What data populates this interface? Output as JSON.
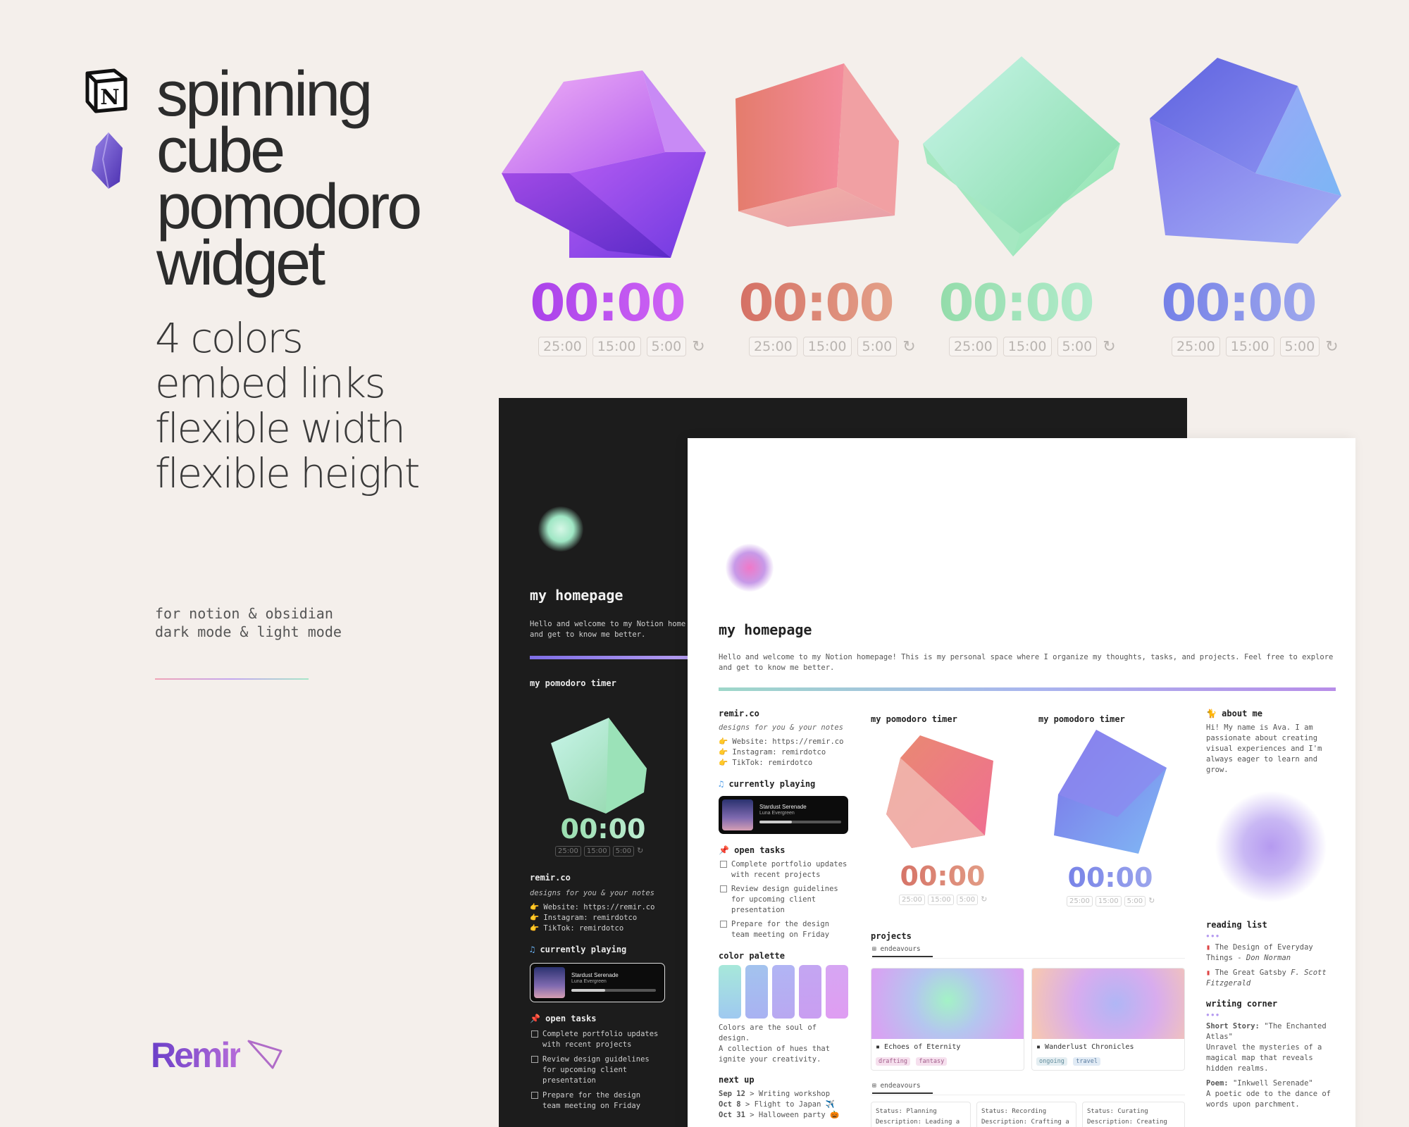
{
  "hero": {
    "title_lines": [
      "spinning",
      "cube",
      "pomodoro",
      "widget"
    ],
    "features": [
      "4 colors",
      "embed links",
      "flexible width",
      "flexible height"
    ],
    "tagline": [
      "for notion & obsidian",
      "dark mode & light mode"
    ],
    "brand": "Remir"
  },
  "widgets": [
    {
      "time": "00:00",
      "presets": [
        "25:00",
        "15:00",
        "5:00"
      ],
      "color": "purple"
    },
    {
      "time": "00:00",
      "presets": [
        "25:00",
        "15:00",
        "5:00"
      ],
      "color": "coral"
    },
    {
      "time": "00:00",
      "presets": [
        "25:00",
        "15:00",
        "5:00"
      ],
      "color": "mint"
    },
    {
      "time": "00:00",
      "presets": [
        "25:00",
        "15:00",
        "5:00"
      ],
      "color": "blue"
    }
  ],
  "colors": {
    "purple": [
      "#a23be8",
      "#d86cf7"
    ],
    "coral": [
      "#d2675e",
      "#e6a98f"
    ],
    "mint": [
      "#8ed9a4",
      "#b6eed1"
    ],
    "blue": [
      "#6c78e6",
      "#a7b0ee"
    ],
    "bg": "#f4efeb",
    "dark_bg": "#1c1c1c"
  },
  "dark": {
    "title": "my homepage",
    "intro_1": "Hello and welcome to my Notion home",
    "intro_2": "and get to know me better.",
    "pomodoro_heading": "my pomodoro timer",
    "timer": "00:00",
    "presets": [
      "25:00",
      "15:00",
      "5:00"
    ],
    "remir_heading": "remir.co",
    "remir_sub": "designs for you & your notes",
    "links": [
      "Website: https://remir.co",
      "Instagram: remirdotco",
      "TikTok: remirdotco"
    ],
    "playing_heading": "currently playing",
    "song": "Stardust Serenade",
    "artist": "Luna Evergreen",
    "tasks_heading": "open tasks",
    "tasks": [
      [
        "Complete portfolio updates",
        "with recent projects"
      ],
      [
        "Review design guidelines",
        "for upcoming client",
        "presentation"
      ],
      [
        "Prepare for the design",
        "team meeting on Friday"
      ]
    ]
  },
  "light": {
    "title": "my homepage",
    "intro_1": "Hello and welcome to my Notion homepage! This is my personal space where I organize my thoughts, tasks, and projects. Feel free to explore",
    "intro_2": "and get to know me better.",
    "remir_heading": "remir.co",
    "remir_sub": "designs for you & your notes",
    "links": [
      "Website: https://remir.co",
      "Instagram: remirdotco",
      "TikTok: remirdotco"
    ],
    "playing_heading": "currently playing",
    "song": "Stardust Serenade",
    "artist": "Luna Evergreen",
    "tasks_heading": "open tasks",
    "tasks": [
      [
        "Complete portfolio updates",
        "with recent projects"
      ],
      [
        "Review design guidelines",
        "for upcoming client",
        "presentation"
      ],
      [
        "Prepare for the design",
        "team meeting on Friday"
      ]
    ],
    "palette_heading": "color palette",
    "palette_text": [
      "Colors are the soul of",
      "design.",
      "A collection of hues that",
      "ignite your creativity."
    ],
    "palette_colors": [
      "#9fdcd3",
      "#a3c3ee",
      "#b7aef3",
      "#c79cf2",
      "#d9a2f3"
    ],
    "nextup_heading": "next up",
    "nextup": [
      {
        "date": "Sep 12",
        "text": "> Writing workshop"
      },
      {
        "date": "Oct 8",
        "text": "> Flight to Japan ✈️"
      },
      {
        "date": "Oct 31",
        "text": "> Halloween party 🎃"
      }
    ],
    "pomo1_heading": "my pomodoro timer",
    "pomo2_heading": "my pomodoro timer",
    "timer1": "00:00",
    "timer2": "00:00",
    "presets": [
      "25:00",
      "15:00",
      "5:00"
    ],
    "projects_heading": "projects",
    "view_label": "endeavours",
    "view_label_2": "endeavours",
    "projects": [
      {
        "name": "Echoes of Eternity",
        "tags": [
          "drafting",
          "fantasy"
        ]
      },
      {
        "name": "Wanderlust Chronicles",
        "tags": [
          "ongoing",
          "travel"
        ]
      }
    ],
    "status_cards": [
      {
        "status": "Status: Planning",
        "desc": "Description: Leading a"
      },
      {
        "status": "Status: Recording",
        "desc": "Description: Crafting a"
      },
      {
        "status": "Status: Curating",
        "desc": "Description: Creating"
      }
    ],
    "about_heading": "about me",
    "about_text": [
      "Hi! My name is Ava. I am",
      "passionate about creating",
      "visual experiences and I'm",
      "always eager to learn and",
      "grow."
    ],
    "reading_heading": "reading list",
    "reading": [
      {
        "title": "The Design of Everyday",
        "title2": "Things - ",
        "author": "Don Norman"
      },
      {
        "title": "The Great Gatsby ",
        "title2": "",
        "author": "F. Scott Fitzgerald"
      }
    ],
    "writing_heading": "writing corner",
    "story_label": "Short Story:",
    "story_title": "\"The Enchanted",
    "story_lines": [
      "Atlas\"",
      "Unravel the mysteries of a",
      "magical map that reveals",
      "hidden realms."
    ],
    "poem_label": "Poem:",
    "poem_title": "\"Inkwell Serenade\"",
    "poem_lines": [
      "A poetic ode to the dance of",
      "words upon parchment."
    ]
  }
}
